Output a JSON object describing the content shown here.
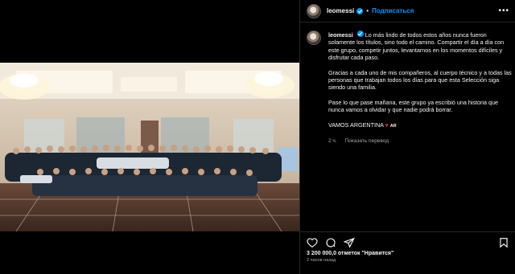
{
  "post": {
    "username": "leomessi",
    "follow_label": "Подписаться",
    "separator": "•",
    "more_label": "•••"
  },
  "caption": {
    "username": "leomessi",
    "paragraphs": [
      "Lo más lindo de todos estos años nunca fueron solamente los títulos, sino todo el camino. Compartir el día a día con este grupo, competir juntos, levantarnos en los momentos difíciles y disfrutar cada paso.",
      "Gracias a cada uno de mis compañeros, al cuerpo técnico y a todas las personas que trabajan todos los días para que esta Selección siga siendo una familia.",
      "Pase lo que pase mañana, este grupo ya escribió una historia que nunca vamos a olvidar y que nadie podrá borrar."
    ],
    "closing": "VAMOS ARGENTINA",
    "closing_flag": "AR",
    "time": "2 ч.",
    "translate_label": "Показать перевод"
  },
  "stats": {
    "likes": "3 200 000,0 отметок \"Нравится\"",
    "posted_ago": "2 часов назад"
  },
  "icons": {
    "like": "heart-icon",
    "comment": "comment-icon",
    "share": "share-icon",
    "save": "bookmark-icon"
  },
  "colors": {
    "accent": "#0095f6",
    "background": "#000000",
    "text": "#f5f5f5",
    "muted": "#a8a8a8"
  }
}
